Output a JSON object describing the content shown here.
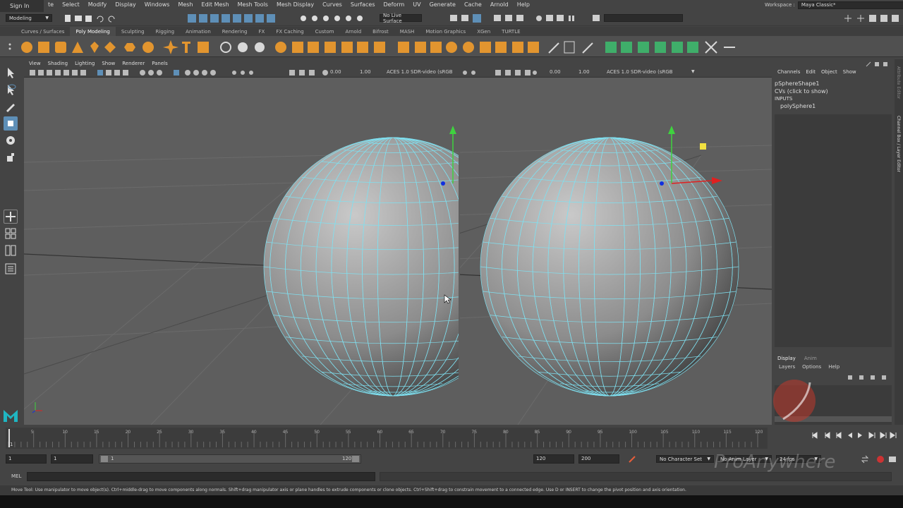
{
  "signin": "Sign In",
  "menubar": {
    "items": [
      "te",
      "Select",
      "Modify",
      "Display",
      "Windows",
      "Mesh",
      "Edit Mesh",
      "Mesh Tools",
      "Mesh Display",
      "Curves",
      "Surfaces",
      "Deform",
      "UV",
      "Generate",
      "Cache",
      "Arnold",
      "Help"
    ]
  },
  "workspace": {
    "label": "Workspace :",
    "value": "Maya Classic*"
  },
  "statusline": {
    "mode": "Modeling",
    "live_surface": "No Live Surface"
  },
  "shelf_tabs": [
    "Curves / Surfaces",
    "Poly Modeling",
    "Sculpting",
    "Rigging",
    "Animation",
    "Rendering",
    "FX",
    "FX Caching",
    "Custom",
    "Arnold",
    "Bifrost",
    "MASH",
    "Motion Graphics",
    "XGen",
    "TURTLE"
  ],
  "shelf_active": "Poly Modeling",
  "viewport": {
    "menu": [
      "View",
      "Shading",
      "Lighting",
      "Show",
      "Renderer",
      "Panels"
    ],
    "left_exposure": "0.00",
    "left_gamma": "1.00",
    "left_colorspace": "ACES 1.0 SDR-video (sRGB",
    "right_exposure": "0.00",
    "right_gamma": "1.00",
    "right_colorspace": "ACES 1.0 SDR-video (sRGB"
  },
  "channelbox": {
    "menu": [
      "Channels",
      "Edit",
      "Object",
      "Show"
    ],
    "shape": "pSphereShape1",
    "cvs": "CVs (click to show)",
    "inputs": "INPUTS",
    "input_node": "polySphere1",
    "side_tabs": "Channel Box / Layer Editor",
    "attr_tab": "Attribute Editor"
  },
  "layers": {
    "tabs": [
      "Display",
      "Anim"
    ],
    "menu": [
      "Layers",
      "Options",
      "Help"
    ]
  },
  "timeslider": {
    "ticks": [
      "5",
      "10",
      "15",
      "20",
      "25",
      "30",
      "35",
      "40",
      "45",
      "50",
      "55",
      "60",
      "65",
      "70",
      "75",
      "80",
      "85",
      "90",
      "95",
      "100",
      "105",
      "110",
      "115",
      "120"
    ],
    "current": "1"
  },
  "range": {
    "start": "1",
    "playback_start": "1",
    "slider_start": "1",
    "slider_end": "120",
    "playback_end": "120",
    "end": "200",
    "character_set": "No Character Set",
    "anim_layer": "No Anim Layer",
    "fps": "24 fps"
  },
  "cmdline": {
    "lang": "MEL"
  },
  "helpline": "Move Tool: Use manipulator to move object(s). Ctrl+middle-drag to move components along normals. Shift+drag manipulator axis or plane handles to extrude components or clone objects. Ctrl+Shift+drag to constrain movement to a connected edge. Use D or INSERT to change the pivot position and axis orientation.",
  "watermark": "ProAnywhere",
  "colors": {
    "accent": "#5e8fb7",
    "wire": "#7fe0f0",
    "shelf_orange": "#e2952f",
    "shelf_green": "#3fae6a",
    "maya_logo": "#1fb6c2"
  }
}
